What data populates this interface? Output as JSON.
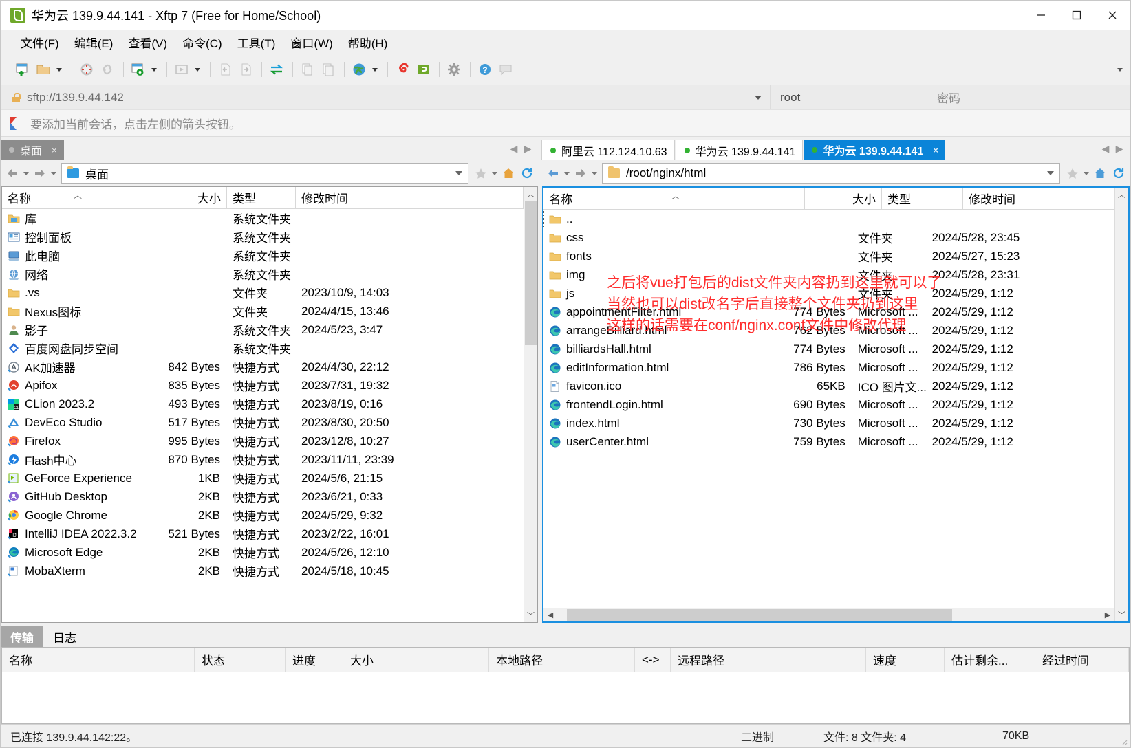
{
  "window": {
    "title": "华为云 139.9.44.141 - Xftp 7 (Free for Home/School)",
    "app_icon": "xftp-icon",
    "minimize_label": "最小化",
    "maximize_label": "最大化",
    "close_label": "关闭"
  },
  "menubar": {
    "items": [
      {
        "label": "文件(F)",
        "name": "menu-file"
      },
      {
        "label": "编辑(E)",
        "name": "menu-edit"
      },
      {
        "label": "查看(V)",
        "name": "menu-view"
      },
      {
        "label": "命令(C)",
        "name": "menu-command"
      },
      {
        "label": "工具(T)",
        "name": "menu-tools"
      },
      {
        "label": "窗口(W)",
        "name": "menu-window"
      },
      {
        "label": "帮助(H)",
        "name": "menu-help"
      }
    ]
  },
  "toolbar": {
    "buttons": [
      {
        "name": "new-session-icon",
        "label": "新建会话"
      },
      {
        "name": "open-folder-icon",
        "label": "打开"
      },
      {
        "name": "disconnect-icon",
        "label": "断开"
      },
      {
        "name": "reconnect-icon",
        "label": "重新连接"
      },
      {
        "name": "session-settings-icon",
        "label": "会话属性"
      },
      {
        "name": "run-icon",
        "label": "运行"
      },
      {
        "name": "transfer-left-icon",
        "label": "传输到左侧"
      },
      {
        "name": "transfer-right-icon",
        "label": "传输到右侧"
      },
      {
        "name": "sync-browse-icon",
        "label": "同步浏览"
      },
      {
        "name": "copy-icon",
        "label": "复制"
      },
      {
        "name": "paste-icon",
        "label": "粘贴"
      },
      {
        "name": "globe-icon",
        "label": "网络"
      },
      {
        "name": "xshell-icon",
        "label": "Xshell"
      },
      {
        "name": "xftp-green-icon",
        "label": "Xftp"
      },
      {
        "name": "gear-icon",
        "label": "选项"
      },
      {
        "name": "help-icon",
        "label": "帮助"
      },
      {
        "name": "feedback-icon",
        "label": "反馈"
      }
    ]
  },
  "address": {
    "url": "sftp://139.9.44.142",
    "user": "root",
    "password_placeholder": "密码"
  },
  "hint": {
    "text": "要添加当前会话，点击左侧的箭头按钮。"
  },
  "left_pane": {
    "tab": {
      "label": "桌面",
      "close": "×"
    },
    "path": "桌面",
    "columns": [
      "名称",
      "大小",
      "类型",
      "修改时间"
    ],
    "rows": [
      {
        "icon": "library-icon",
        "name": "库",
        "size": "",
        "type": "系统文件夹",
        "time": ""
      },
      {
        "icon": "control-panel-icon",
        "name": "控制面板",
        "size": "",
        "type": "系统文件夹",
        "time": ""
      },
      {
        "icon": "this-pc-icon",
        "name": "此电脑",
        "size": "",
        "type": "系统文件夹",
        "time": ""
      },
      {
        "icon": "network-icon",
        "name": "网络",
        "size": "",
        "type": "系统文件夹",
        "time": ""
      },
      {
        "icon": "folder-icon",
        "name": ".vs",
        "size": "",
        "type": "文件夹",
        "time": "2023/10/9, 14:03"
      },
      {
        "icon": "folder-icon",
        "name": "Nexus图标",
        "size": "",
        "type": "文件夹",
        "time": "2024/4/15, 13:46"
      },
      {
        "icon": "user-icon",
        "name": "影子",
        "size": "",
        "type": "系统文件夹",
        "time": "2024/5/23, 3:47"
      },
      {
        "icon": "baidu-icon",
        "name": "百度网盘同步空间",
        "size": "",
        "type": "系统文件夹",
        "time": ""
      },
      {
        "icon": "ak-icon",
        "name": "AK加速器",
        "size": "842 Bytes",
        "type": "快捷方式",
        "time": "2024/4/30, 22:12"
      },
      {
        "icon": "apifox-icon",
        "name": "Apifox",
        "size": "835 Bytes",
        "type": "快捷方式",
        "time": "2023/7/31, 19:32"
      },
      {
        "icon": "clion-icon",
        "name": "CLion 2023.2",
        "size": "493 Bytes",
        "type": "快捷方式",
        "time": "2023/8/19, 0:16"
      },
      {
        "icon": "deveco-icon",
        "name": "DevEco Studio",
        "size": "517 Bytes",
        "type": "快捷方式",
        "time": "2023/8/30, 20:50"
      },
      {
        "icon": "firefox-icon",
        "name": "Firefox",
        "size": "995 Bytes",
        "type": "快捷方式",
        "time": "2023/12/8, 10:27"
      },
      {
        "icon": "flash-icon",
        "name": "Flash中心",
        "size": "870 Bytes",
        "type": "快捷方式",
        "time": "2023/11/11, 23:39"
      },
      {
        "icon": "geforce-icon",
        "name": "GeForce Experience",
        "size": "1KB",
        "type": "快捷方式",
        "time": "2024/5/6, 21:15"
      },
      {
        "icon": "github-icon",
        "name": "GitHub Desktop",
        "size": "2KB",
        "type": "快捷方式",
        "time": "2023/6/21, 0:33"
      },
      {
        "icon": "chrome-icon",
        "name": "Google Chrome",
        "size": "2KB",
        "type": "快捷方式",
        "time": "2024/5/29, 9:32"
      },
      {
        "icon": "intellij-icon",
        "name": "IntelliJ IDEA 2022.3.2",
        "size": "521 Bytes",
        "type": "快捷方式",
        "time": "2023/2/22, 16:01"
      },
      {
        "icon": "edge-icon",
        "name": "Microsoft Edge",
        "size": "2KB",
        "type": "快捷方式",
        "time": "2024/5/26, 12:10"
      },
      {
        "icon": "mobaxterm-icon",
        "name": "MobaXterm",
        "size": "2KB",
        "type": "快捷方式",
        "time": "2024/5/18, 10:45"
      }
    ]
  },
  "right_pane": {
    "tabs": [
      {
        "label": "阿里云 112.124.10.63",
        "active": false,
        "name": "tab-aliyun"
      },
      {
        "label": "华为云 139.9.44.141",
        "active": false,
        "name": "tab-huawei-1"
      },
      {
        "label": "华为云 139.9.44.141",
        "active": true,
        "close": "×",
        "name": "tab-huawei-2"
      }
    ],
    "path": "/root/nginx/html",
    "columns": [
      "名称",
      "大小",
      "类型",
      "修改时间"
    ],
    "rows": [
      {
        "icon": "folder-icon",
        "name": "..",
        "size": "",
        "type": "",
        "time": "",
        "selected": true
      },
      {
        "icon": "folder-icon",
        "name": "css",
        "size": "",
        "type": "文件夹",
        "time": "2024/5/28, 23:45"
      },
      {
        "icon": "folder-icon",
        "name": "fonts",
        "size": "",
        "type": "文件夹",
        "time": "2024/5/27, 15:23"
      },
      {
        "icon": "folder-icon",
        "name": "img",
        "size": "",
        "type": "文件夹",
        "time": "2024/5/28, 23:31"
      },
      {
        "icon": "folder-icon",
        "name": "js",
        "size": "",
        "type": "文件夹",
        "time": "2024/5/29, 1:12"
      },
      {
        "icon": "edge-html-icon",
        "name": "appointmentFilter.html",
        "size": "774 Bytes",
        "type": "Microsoft ...",
        "time": "2024/5/29, 1:12"
      },
      {
        "icon": "edge-html-icon",
        "name": "arrangeBilliard.html",
        "size": "762 Bytes",
        "type": "Microsoft ...",
        "time": "2024/5/29, 1:12"
      },
      {
        "icon": "edge-html-icon",
        "name": "billiardsHall.html",
        "size": "774 Bytes",
        "type": "Microsoft ...",
        "time": "2024/5/29, 1:12"
      },
      {
        "icon": "edge-html-icon",
        "name": "editInformation.html",
        "size": "786 Bytes",
        "type": "Microsoft ...",
        "time": "2024/5/29, 1:12"
      },
      {
        "icon": "ico-file-icon",
        "name": "favicon.ico",
        "size": "65KB",
        "type": "ICO 图片文...",
        "time": "2024/5/29, 1:12"
      },
      {
        "icon": "edge-html-icon",
        "name": "frontendLogin.html",
        "size": "690 Bytes",
        "type": "Microsoft ...",
        "time": "2024/5/29, 1:12"
      },
      {
        "icon": "edge-html-icon",
        "name": "index.html",
        "size": "730 Bytes",
        "type": "Microsoft ...",
        "time": "2024/5/29, 1:12"
      },
      {
        "icon": "edge-html-icon",
        "name": "userCenter.html",
        "size": "759 Bytes",
        "type": "Microsoft ...",
        "time": "2024/5/29, 1:12"
      }
    ],
    "annotation": {
      "color": "#ff2d2d",
      "lines": [
        "之后将vue打包后的dist文件夹内容扔到这里就可以了",
        "当然也可以dist改名字后直接整个文件夹扔到这里",
        "这样的话需要在conf/nginx.conf文件中修改代理"
      ]
    }
  },
  "bottom": {
    "tabs": [
      {
        "label": "传输",
        "selected": true,
        "name": "tab-transfer"
      },
      {
        "label": "日志",
        "selected": false,
        "name": "tab-log"
      }
    ],
    "columns": [
      "名称",
      "状态",
      "进度",
      "大小",
      "本地路径",
      "<->",
      "远程路径",
      "速度",
      "估计剩余...",
      "经过时间"
    ]
  },
  "statusbar": {
    "connection": "已连接 139.9.44.142:22。",
    "mode": "二进制",
    "counts": "文件: 8 文件夹: 4",
    "total_size": "70KB"
  }
}
